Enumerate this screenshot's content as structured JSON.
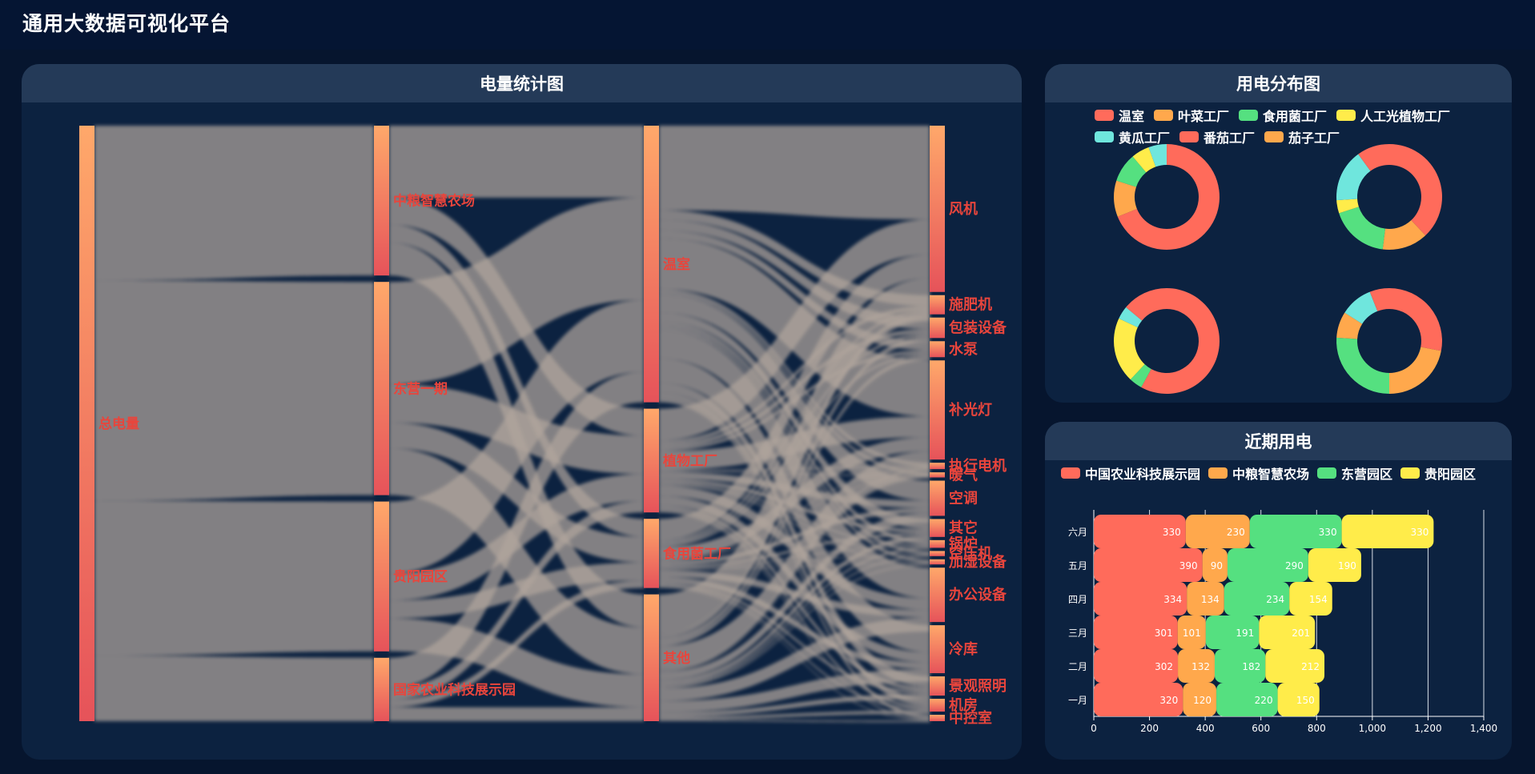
{
  "app": {
    "title": "通用大数据可视化平台"
  },
  "panels": {
    "sankey": {
      "title": "电量统计图"
    },
    "pies": {
      "title": "用电分布图"
    },
    "bars": {
      "title": "近期用电"
    }
  },
  "colors": {
    "red": "#ff6b5b",
    "orange": "#ffa84c",
    "green": "#55e080",
    "yellow": "#ffec4a",
    "cyan": "#6fe6dd",
    "sankey_label": "#e8453c"
  },
  "chart_data": [
    {
      "type": "sankey",
      "columns": [
        [
          "总电量"
        ],
        [
          "中粮智慧农场",
          "东营一期",
          "贵阳园区",
          "国家农业科技展示园"
        ],
        [
          "温室",
          "植物工厂",
          "食用菌工厂",
          "其他"
        ],
        [
          "风机",
          "施肥机",
          "包装设备",
          "水泵",
          "补光灯",
          "执行电机",
          "暖气",
          "空调",
          "其它",
          "锅炉",
          "空压机",
          "加湿设备",
          "办公设备",
          "冷库",
          "景观照明",
          "机房",
          "中控室"
        ]
      ],
      "node_values": {
        "总电量": 1000,
        "中粮智慧农场": 260,
        "东营一期": 370,
        "贵阳园区": 260,
        "国家农业科技展示园": 110,
        "温室": 480,
        "植物工厂": 180,
        "食用菌工厂": 120,
        "其他": 220,
        "风机": 260,
        "施肥机": 30,
        "包装设备": 32,
        "水泵": 25,
        "补光灯": 155,
        "执行电机": 10,
        "暖气": 8,
        "空调": 55,
        "其它": 28,
        "锅炉": 12,
        "空压机": 8,
        "加湿设备": 8,
        "办公设备": 85,
        "冷库": 75,
        "景观照明": 30,
        "机房": 20,
        "中控室": 10
      }
    },
    {
      "type": "pie",
      "legend": [
        "温室",
        "叶菜工厂",
        "食用菌工厂",
        "人工光植物工厂",
        "黄瓜工厂",
        "番茄工厂",
        "茄子工厂"
      ],
      "pies": [
        {
          "values": [
            62,
            10,
            8,
            5,
            5
          ],
          "colors": [
            "red",
            "orange",
            "green",
            "yellow",
            "cyan"
          ]
        },
        {
          "values": [
            38,
            14,
            18,
            4,
            16,
            10
          ],
          "colors": [
            "red",
            "orange",
            "green",
            "yellow",
            "cyan",
            "red"
          ]
        },
        {
          "values": [
            58,
            4,
            20,
            4,
            14
          ],
          "colors": [
            "red",
            "green",
            "yellow",
            "cyan",
            "red"
          ]
        },
        {
          "values": [
            28,
            22,
            26,
            8,
            10,
            6
          ],
          "colors": [
            "red",
            "orange",
            "green",
            "orange",
            "cyan",
            "red"
          ]
        }
      ]
    },
    {
      "type": "bar",
      "orientation": "horizontal-stacked",
      "categories": [
        "六月",
        "五月",
        "四月",
        "三月",
        "二月",
        "一月"
      ],
      "series": [
        {
          "name": "中国农业科技展示园",
          "color": "red",
          "values": [
            330,
            390,
            334,
            301,
            302,
            320
          ]
        },
        {
          "name": "中粮智慧农场",
          "color": "orange",
          "values": [
            230,
            90,
            134,
            101,
            132,
            120
          ]
        },
        {
          "name": "东营园区",
          "color": "green",
          "values": [
            330,
            290,
            234,
            191,
            182,
            220
          ]
        },
        {
          "name": "贵阳园区",
          "color": "yellow",
          "values": [
            330,
            190,
            154,
            201,
            212,
            150
          ]
        }
      ],
      "xlim": [
        0,
        1400
      ],
      "xticks": [
        "0",
        "200",
        "400",
        "600",
        "800",
        "1,000",
        "1,200",
        "1,400"
      ]
    }
  ]
}
